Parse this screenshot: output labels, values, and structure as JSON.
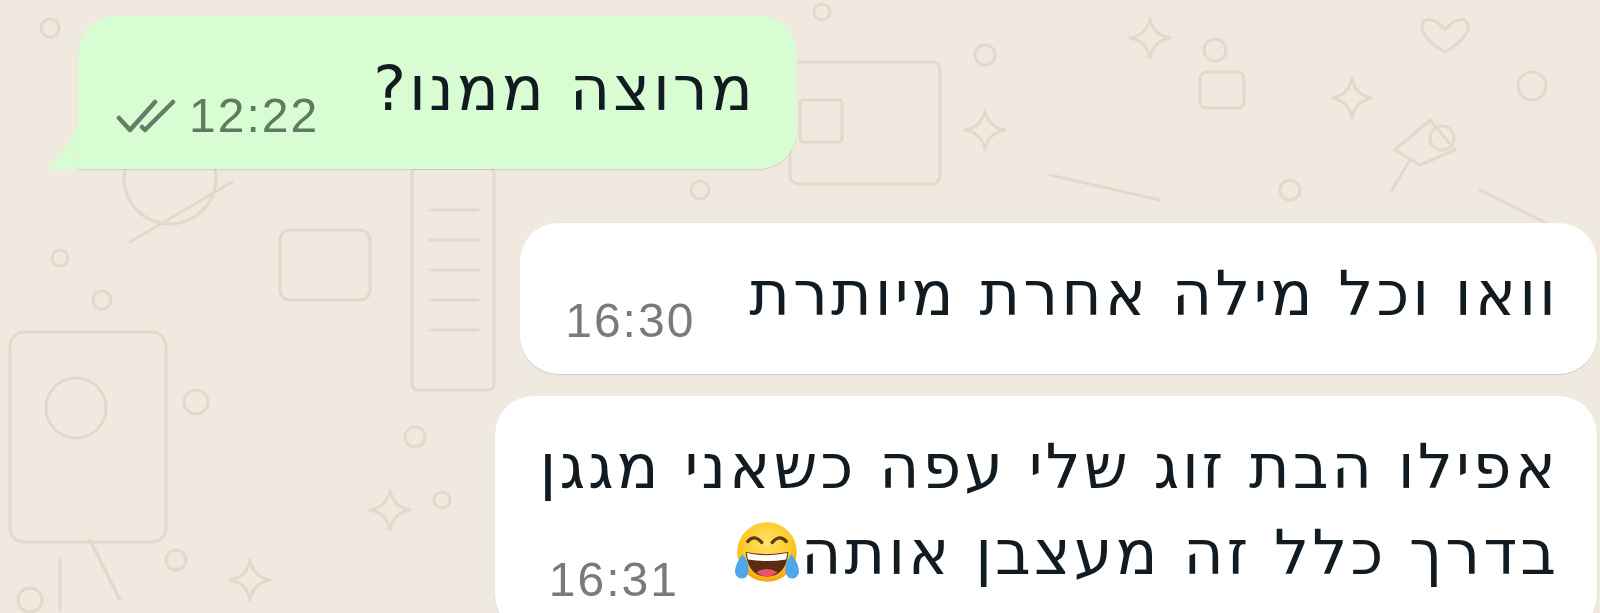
{
  "messages": [
    {
      "kind": "outgoing",
      "lines": [
        "מרוצה ממנו?"
      ],
      "time": "12:22",
      "delivered": true,
      "read": false,
      "tail": true,
      "trailing_emoji": false
    },
    {
      "kind": "incoming",
      "lines": [
        "וואו וכל מילה אחרת מיותרת"
      ],
      "time": "16:30",
      "tail": false,
      "trailing_emoji": false
    },
    {
      "kind": "incoming",
      "lines": [
        "אפילו הבת זוג שלי עפה כשאני מגגן",
        "בדרך כלל זה מעצבן אותה"
      ],
      "time": "16:31",
      "tail": false,
      "trailing_emoji": true
    }
  ]
}
